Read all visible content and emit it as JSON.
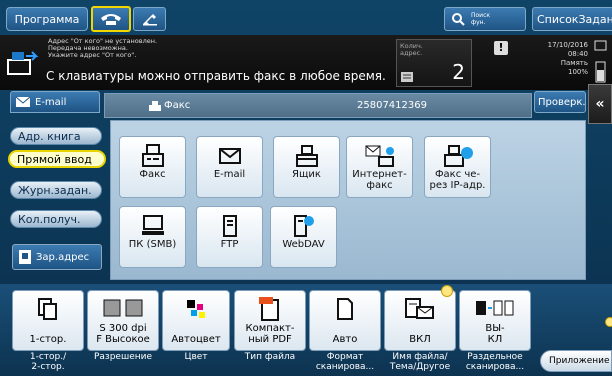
{
  "top": {
    "program": "Программа",
    "search_l1": "Поиск",
    "search_l2": "фун.",
    "job_list": "СписокЗаданий"
  },
  "message": {
    "lines": [
      "Адрес \"От кого\" не установлен.",
      "Передача невозможна.",
      "Укажите адрес \"От кого\"."
    ],
    "main": "С клавиатуры можно отправить факс в любое время.",
    "count_label_l1": "Колич.",
    "count_label_l2": "адрес.",
    "count": "2",
    "date": "17/10/2016",
    "time": "08:40",
    "memory_label": "Память",
    "memory_value": "100%"
  },
  "email_tab": "E-mail",
  "fax_bar": {
    "label": "Факс",
    "number": "25807412369"
  },
  "check_button": "Проверк.н",
  "sidebar": [
    {
      "label": "Адр. книга",
      "active": false
    },
    {
      "label": "Прямой ввод",
      "active": true
    },
    {
      "label": "Журн.задан.",
      "active": false
    },
    {
      "label": "Кол.получ.",
      "active": false
    }
  ],
  "register_address": "Зар.адрес",
  "tiles": [
    {
      "label": "Факс",
      "icon": "fax-icon"
    },
    {
      "label": "E-mail",
      "icon": "envelope-icon"
    },
    {
      "label": "Ящик",
      "icon": "box-icon"
    },
    {
      "label": "Интернет-\nфакс",
      "icon": "internet-fax-icon"
    },
    {
      "label": "Факс че-\nрез IP-адр.",
      "icon": "ip-fax-icon"
    },
    {
      "label": "ПК (SMB)",
      "icon": "pc-icon"
    },
    {
      "label": "FTP",
      "icon": "ftp-server-icon"
    },
    {
      "label": "WebDAV",
      "icon": "webdav-server-icon"
    }
  ],
  "settings": [
    {
      "value": "1-стор.",
      "caption": "1-стор./\n2-стор.",
      "icon": "single-side-icon"
    },
    {
      "value": "S 300 dpi\nF Высокое",
      "caption": "Разрешение",
      "icon": "resolution-icon"
    },
    {
      "value": "Автоцвет",
      "caption": "Цвет",
      "icon": "auto-color-icon"
    },
    {
      "value": "Компакт-\nный PDF",
      "caption": "Тип файла",
      "icon": "pdf-icon"
    },
    {
      "value": "Авто",
      "caption": "Формат\nсканирова...",
      "icon": "page-size-icon"
    },
    {
      "value": "ВКЛ",
      "caption": "Имя файла/\nТема/Другое",
      "icon": "file-mail-icon"
    },
    {
      "value": "ВЫ-\nКЛ",
      "caption": "Раздельное\nсканирова...",
      "icon": "separate-scan-icon"
    }
  ],
  "apps_button": "Приложение"
}
